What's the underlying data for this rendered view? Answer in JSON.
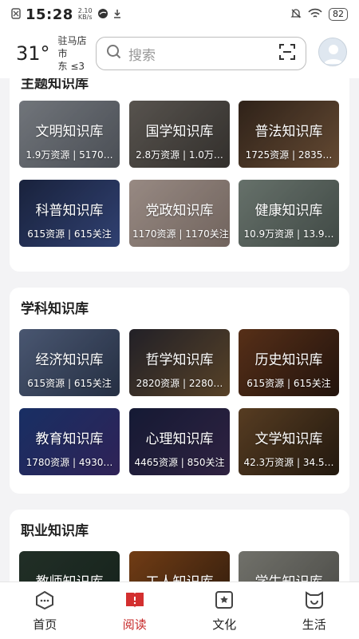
{
  "status": {
    "time": "15:28",
    "speed": "2.10",
    "speed_unit": "KB/s",
    "battery": "82"
  },
  "header": {
    "temperature": "31°",
    "location_line1": "驻马店市",
    "location_line2": "东 ≤3",
    "search_placeholder": "搜索"
  },
  "sections": [
    {
      "title": "主题知识库",
      "tiles": [
        {
          "name": "文明知识库",
          "stats": "1.9万资源 | 5170…",
          "bg": "linear-gradient(135deg,#8a8f96,#5b6068)"
        },
        {
          "name": "国学知识库",
          "stats": "2.8万资源 | 1.0万…",
          "bg": "linear-gradient(135deg,#6b6660,#3e3a36)"
        },
        {
          "name": "普法知识库",
          "stats": "1725资源 | 2835…",
          "bg": "linear-gradient(135deg,#3a2a1f,#7a5a3e)"
        },
        {
          "name": "科普知识库",
          "stats": "615资源 | 615关注",
          "bg": "linear-gradient(135deg,#1f2a4a,#3b4f8a)"
        },
        {
          "name": "党政知识库",
          "stats": "1170资源 | 1170关注",
          "bg": "linear-gradient(135deg,#b9a8a0,#8a7a72)"
        },
        {
          "name": "健康知识库",
          "stats": "10.9万资源 | 13.9…",
          "bg": "linear-gradient(135deg,#7d8a82,#4f5a55)"
        }
      ]
    },
    {
      "title": "学科知识库",
      "tiles": [
        {
          "name": "经济知识库",
          "stats": "615资源 | 615关注",
          "bg": "linear-gradient(135deg,#5a6a8a,#2e3a52)"
        },
        {
          "name": "哲学知识库",
          "stats": "2820资源 | 2280…",
          "bg": "linear-gradient(135deg,#2a2830,#6a5030)"
        },
        {
          "name": "历史知识库",
          "stats": "615资源 | 615关注",
          "bg": "linear-gradient(135deg,#6a3a1e,#2a1810)"
        },
        {
          "name": "教育知识库",
          "stats": "1780资源 | 4930…",
          "bg": "linear-gradient(135deg,#1e3a7a,#3a2a6a)"
        },
        {
          "name": "心理知识库",
          "stats": "4465资源 | 850关注",
          "bg": "linear-gradient(135deg,#1a2040,#3a2a50)"
        },
        {
          "name": "文学知识库",
          "stats": "42.3万资源 | 34.5…",
          "bg": "linear-gradient(135deg,#6a4a2a,#2a1e12)"
        }
      ]
    },
    {
      "title": "职业知识库",
      "tiles": [
        {
          "name": "教师知识库",
          "stats": "",
          "bg": "linear-gradient(135deg,#2a3a30,#1a2a22)"
        },
        {
          "name": "工人知识库",
          "stats": "",
          "bg": "linear-gradient(135deg,#8a4a1a,#3a2210)"
        },
        {
          "name": "学生知识库",
          "stats": "",
          "bg": "linear-gradient(135deg,#8a8a82,#5a5a55)"
        }
      ]
    }
  ],
  "tabs": [
    {
      "label": "首页",
      "icon": "home-icon"
    },
    {
      "label": "阅读",
      "icon": "book-icon"
    },
    {
      "label": "文化",
      "icon": "culture-icon"
    },
    {
      "label": "生活",
      "icon": "life-icon"
    }
  ],
  "colors": {
    "accent": "#c62828"
  }
}
